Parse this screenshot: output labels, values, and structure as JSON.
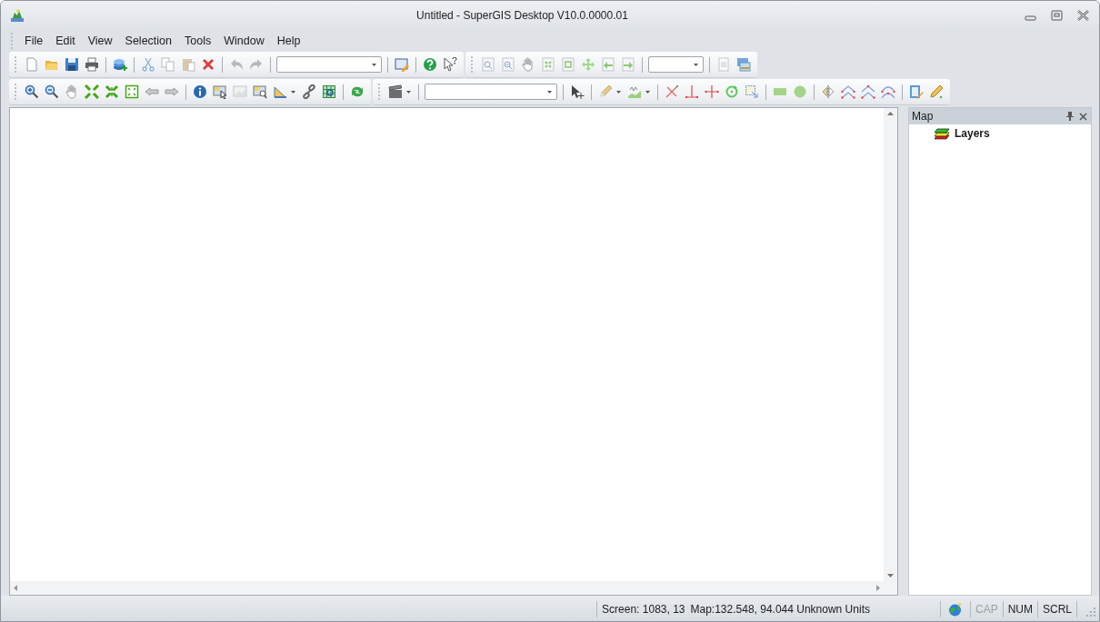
{
  "window": {
    "title": "Untitled - SuperGIS Desktop V10.0.0000.01"
  },
  "menu": [
    {
      "label": "File"
    },
    {
      "label": "Edit"
    },
    {
      "label": "View"
    },
    {
      "label": "Selection"
    },
    {
      "label": "Tools"
    },
    {
      "label": "Window"
    },
    {
      "label": "Help"
    }
  ],
  "map_panel": {
    "title": "Map",
    "tree": [
      {
        "label": "Layers"
      }
    ]
  },
  "status_bar": {
    "screen": "Screen: 1083, 13",
    "map": "Map:132.548, 94.044 Unknown Units",
    "indicators": [
      {
        "label": "CAP",
        "on": false
      },
      {
        "label": "NUM",
        "on": true
      },
      {
        "label": "SCRL",
        "on": true
      }
    ]
  }
}
